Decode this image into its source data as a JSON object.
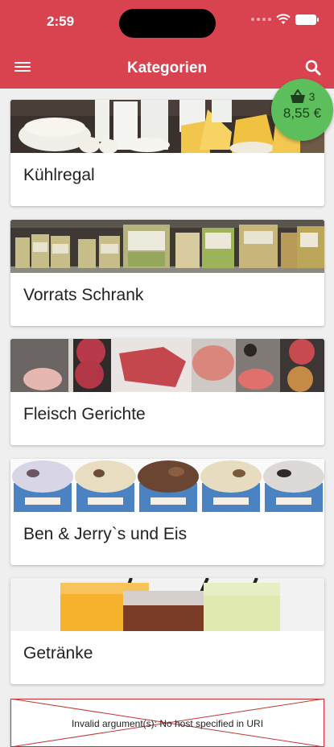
{
  "status_bar": {
    "time": "2:59"
  },
  "app_bar": {
    "title": "Kategorien",
    "menu_icon": "hamburger-menu-icon",
    "search_icon": "search-icon"
  },
  "colors": {
    "brand": "#d8434f",
    "cart_badge": "#5dbe5c",
    "background": "#efefef"
  },
  "cart": {
    "count": "3",
    "total": "8,55 €",
    "icon": "basket-icon"
  },
  "categories": [
    {
      "label": "Kühlregal",
      "image": "dairy-products-image"
    },
    {
      "label": "Vorrats Schrank",
      "image": "pantry-jars-image"
    },
    {
      "label": "Fleisch Gerichte",
      "image": "meat-cuts-image"
    },
    {
      "label": "Ben & Jerry`s und Eis",
      "image": "ice-cream-cups-image"
    },
    {
      "label": "Getränke",
      "image": "drinks-glasses-image"
    }
  ],
  "broken_image": {
    "message": "Invalid argument(s): No host specified in URI"
  }
}
